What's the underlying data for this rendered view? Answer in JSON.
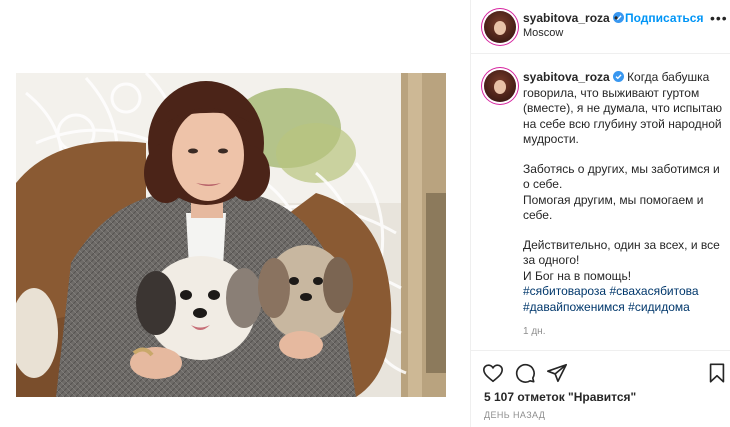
{
  "header": {
    "username": "syabitova_roza",
    "separator": "•",
    "follow_label": "Подписаться",
    "location": "Moscow",
    "more_label": "•••"
  },
  "caption": {
    "username": "syabitova_roza",
    "paragraph1": "Когда бабушка говорила, что выживают гуртом (вместе), я не думала, что испытаю на себе всю глубину этой народной мудрости.",
    "paragraph2_line1": "Заботясь о других, мы заботимся и о себе.",
    "paragraph2_line2": "Помогая другим, мы помогаем и себе.",
    "paragraph3_line1": "Действительно, один за всех, и все за одного!",
    "paragraph3_line2": "И Бог на в помощь!",
    "hashtags": [
      "#сябитовароза",
      "#свахасябитова",
      "#давайпоженимся",
      "#сидидома"
    ],
    "time_ago": "1 дн."
  },
  "actions": {
    "icons": [
      "heart-icon",
      "comment-icon",
      "share-icon",
      "bookmark-icon"
    ],
    "likes_text": "5 107 отметок \"Нравится\"",
    "date_text": "ДЕНЬ НАЗАД"
  },
  "colors": {
    "accent_blue": "#0095f6",
    "hashtag": "#00376b",
    "muted": "#8e8e8e",
    "text": "#262626"
  }
}
